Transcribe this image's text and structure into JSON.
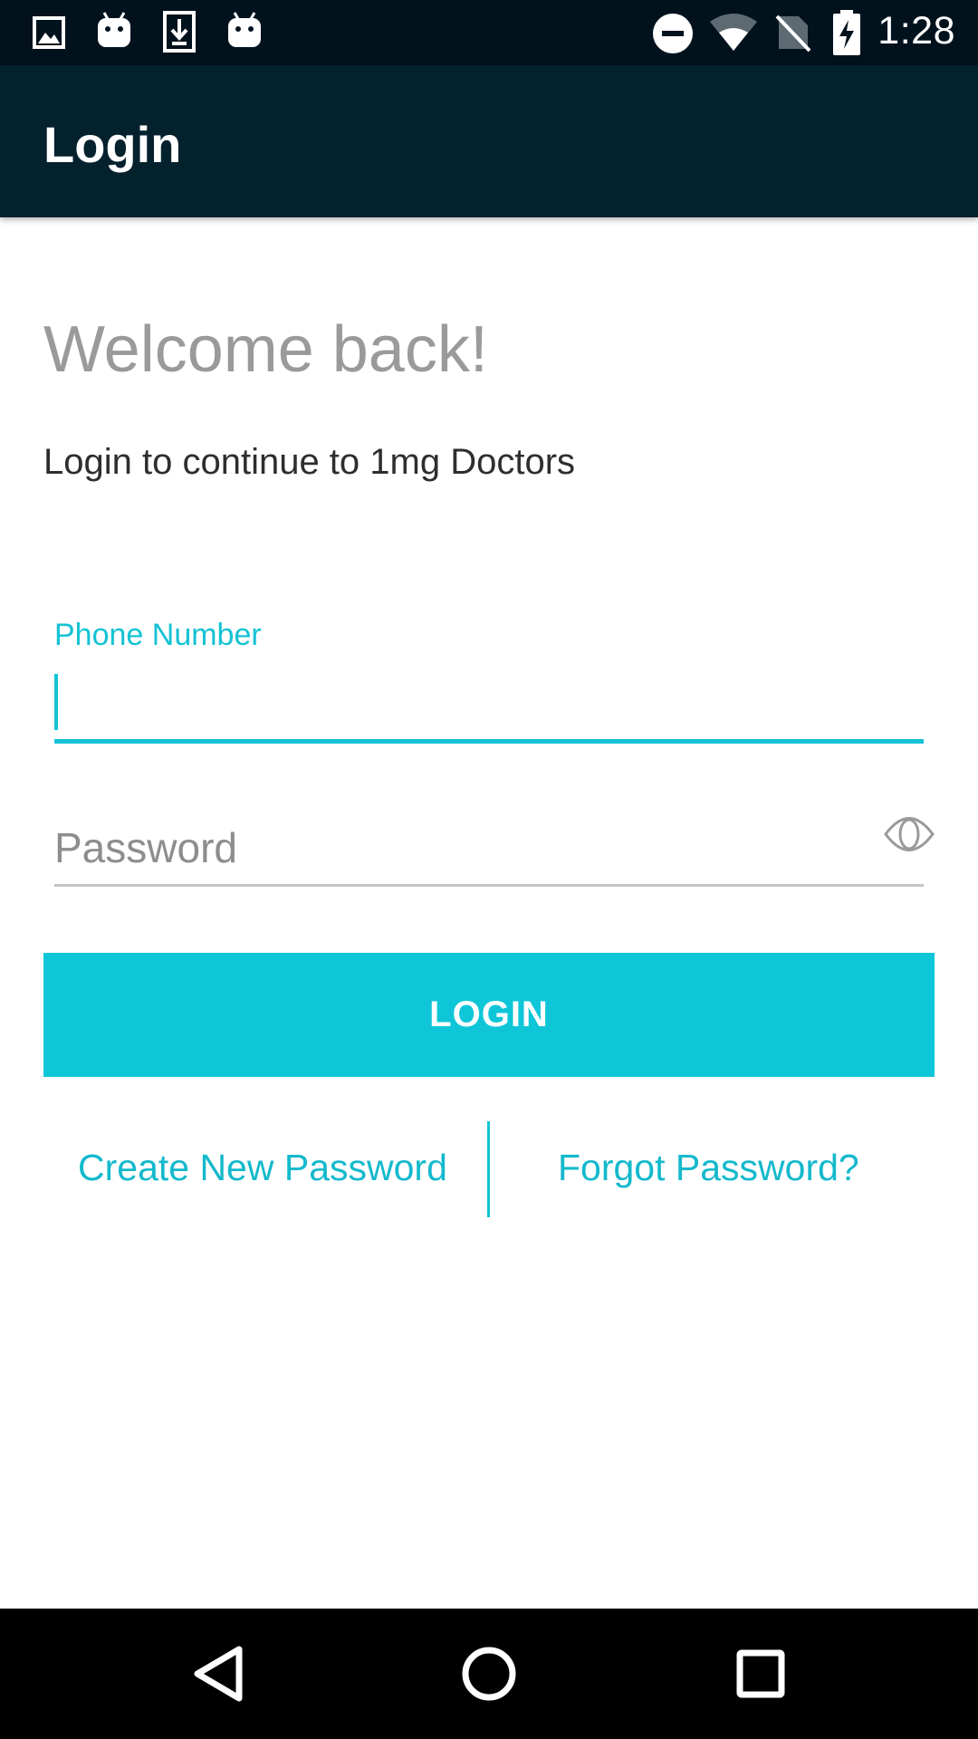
{
  "status_bar": {
    "time": "1:28",
    "left_icons": [
      "image-icon",
      "android-icon",
      "download-icon",
      "android-icon"
    ],
    "right_icons": [
      "do-not-disturb-icon",
      "wifi-icon",
      "no-sim-icon",
      "battery-charging-icon"
    ]
  },
  "app_bar": {
    "title": "Login"
  },
  "main": {
    "welcome": "Welcome back!",
    "subtitle": "Login to continue to 1mg Doctors",
    "phone": {
      "label": "Phone Number",
      "value": ""
    },
    "password": {
      "placeholder": "Password",
      "value": ""
    },
    "login_button": "LOGIN",
    "links": {
      "create_password": "Create New Password",
      "forgot_password": "Forgot Password?"
    }
  },
  "nav_bar": {
    "buttons": [
      "back-icon",
      "home-icon",
      "recents-icon"
    ]
  },
  "colors": {
    "accent": "#0fc6d8",
    "app_bar": "#04212e",
    "status_bar": "#02121d"
  }
}
